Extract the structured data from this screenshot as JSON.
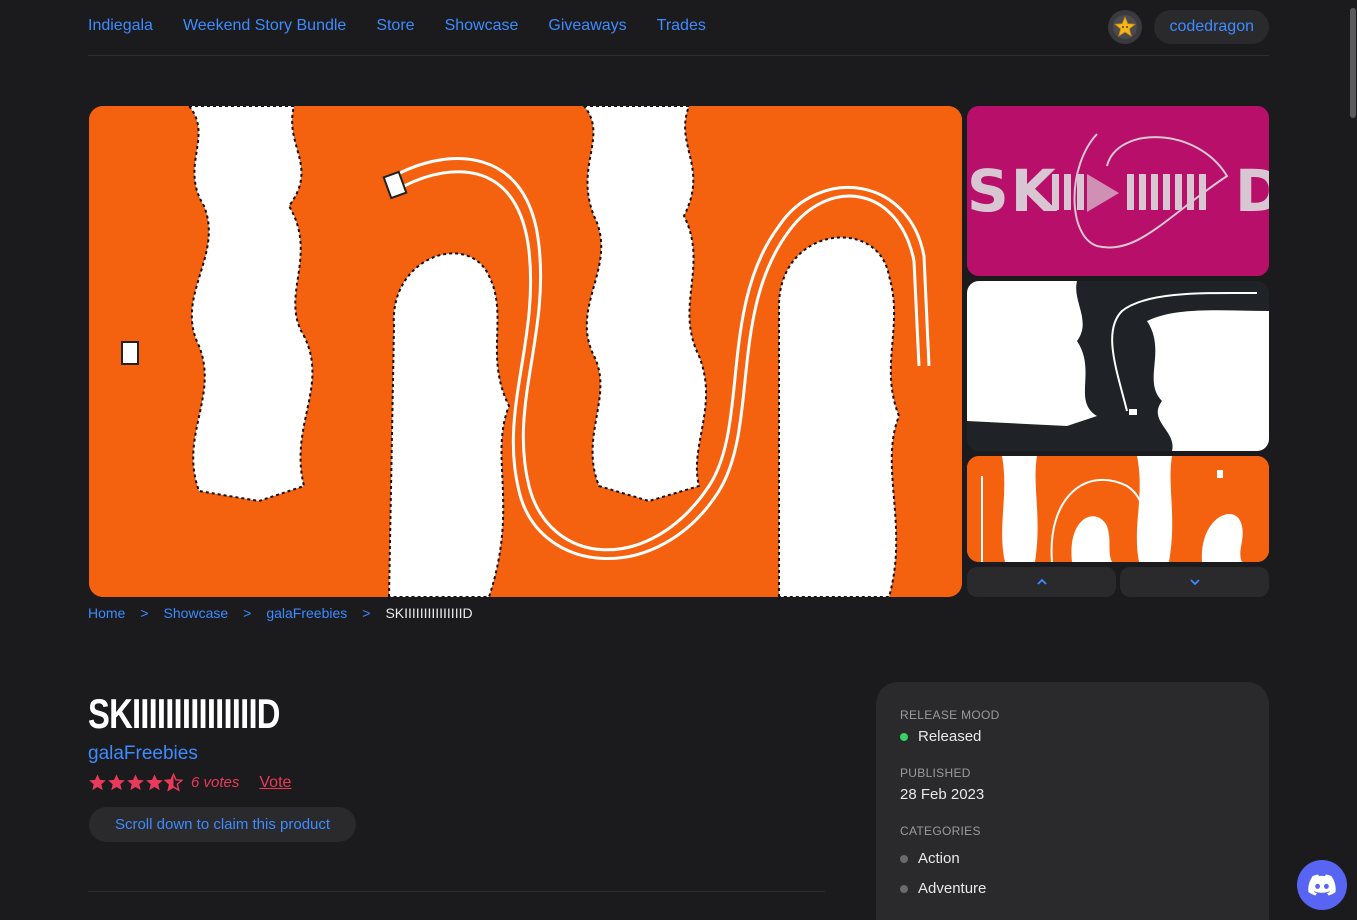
{
  "nav": {
    "links": [
      "Indiegala",
      "Weekend Story Bundle",
      "Store",
      "Showcase",
      "Giveaways",
      "Trades"
    ],
    "username": "codedragon",
    "avatar_icon": "star-avatar-icon"
  },
  "breadcrumb": {
    "items": [
      "Home",
      "Showcase",
      "galaFreebies"
    ],
    "separator": ">",
    "current": "SKIIIIIIIIIIIIIIID"
  },
  "product": {
    "title": "SKIIIIIIIIIIIIIIID",
    "developer": "galaFreebies",
    "rating": 4.5,
    "votes_label": "6 votes",
    "vote_link": "Vote",
    "claim_button": "Scroll down to claim this product"
  },
  "info": {
    "release_label": "RELEASE MOOD",
    "release_value": "Released",
    "published_label": "PUBLISHED",
    "published_value": "28 Feb 2023",
    "categories_label": "CATEGORIES",
    "categories": [
      "Action",
      "Adventure"
    ]
  },
  "colors": {
    "accent": "#3d8bff",
    "rating": "#e83a5a",
    "status_green": "#36d164",
    "media_orange": "#f5620f",
    "media_magenta": "#b80f6a"
  }
}
